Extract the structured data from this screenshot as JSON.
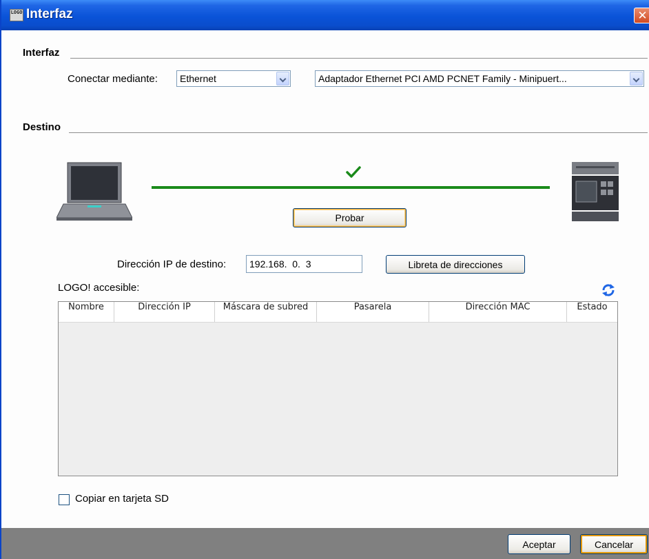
{
  "window": {
    "title": "Interfaz",
    "app_icon_text": "LOGO"
  },
  "interfaz_group": {
    "label": "Interfaz",
    "connect_label": "Conectar mediante:",
    "connect_value": "Ethernet",
    "adapter_value": "Adaptador Ethernet PCI AMD PCNET Family - Minipuert..."
  },
  "destino_group": {
    "label": "Destino",
    "test_button": "Probar",
    "connection_status": "ok",
    "status_color": "#1a8a1a"
  },
  "ip": {
    "label": "Dirección IP de destino:",
    "value": "192.168.  0.  3",
    "address_book_button": "Libreta de direcciones"
  },
  "accessible": {
    "label": "LOGO! accesible:",
    "refresh_icon": "refresh-icon",
    "columns": [
      "Nombre",
      "Dirección IP",
      "Máscara de subred",
      "Pasarela",
      "Dirección MAC",
      "Estado"
    ],
    "rows": []
  },
  "sd": {
    "label": "Copiar en tarjeta SD",
    "checked": false
  },
  "footer": {
    "accept": "Aceptar",
    "cancel": "Cancelar"
  }
}
